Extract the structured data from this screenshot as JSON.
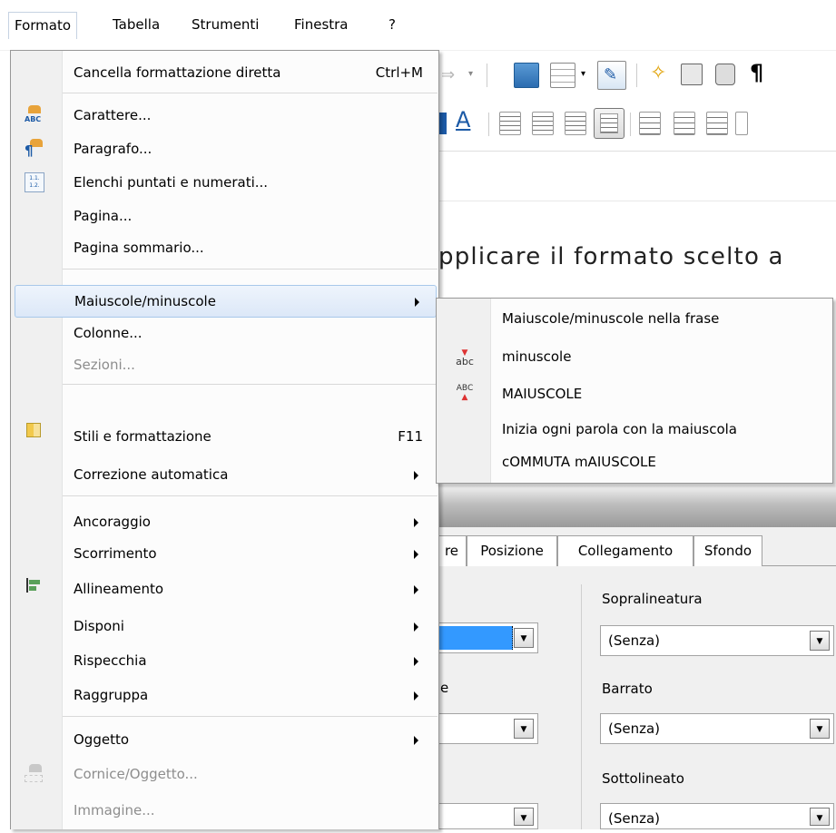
{
  "menubar": {
    "items": [
      "Formato",
      "Tabella",
      "Strumenti",
      "Finestra",
      "?"
    ]
  },
  "document": {
    "text": "pplicare il formato scelto a"
  },
  "format_menu": {
    "items": [
      {
        "label": "Cancella formattazione diretta",
        "shortcut": "Ctrl+M"
      },
      {
        "label": "Carattere...",
        "icon": "character-icon"
      },
      {
        "label": "Paragrafo...",
        "icon": "paragraph-icon"
      },
      {
        "label": "Elenchi puntati e numerati...",
        "icon": "bullets-numbering-icon"
      },
      {
        "label": "Pagina..."
      },
      {
        "label": "Pagina sommario..."
      },
      {
        "label": "Maiuscole/minuscole",
        "submenu": true
      },
      {
        "label": "Colonne..."
      },
      {
        "label": "Sezioni...",
        "disabled": true
      },
      {
        "label": "Stili e formattazione",
        "shortcut": "F11",
        "icon": "styles-icon"
      },
      {
        "label": "Correzione automatica",
        "submenu": true
      },
      {
        "label": "Ancoraggio",
        "submenu": true
      },
      {
        "label": "Scorrimento",
        "submenu": true
      },
      {
        "label": "Allineamento",
        "submenu": true,
        "icon": "align-icon"
      },
      {
        "label": "Disponi",
        "submenu": true
      },
      {
        "label": "Rispecchia",
        "submenu": true
      },
      {
        "label": "Raggruppa",
        "submenu": true
      },
      {
        "label": "Oggetto",
        "submenu": true
      },
      {
        "label": "Cornice/Oggetto...",
        "disabled": true,
        "icon": "frame-icon"
      },
      {
        "label": "Immagine...",
        "disabled": true
      }
    ]
  },
  "case_submenu": {
    "items": [
      {
        "label": "Maiuscole/minuscole nella frase"
      },
      {
        "label": "minuscole",
        "icon": "lowercase-icon",
        "icon_text": "abc"
      },
      {
        "label": "MAIUSCOLE",
        "icon": "uppercase-icon",
        "icon_text": "ABC"
      },
      {
        "label": "Inizia ogni parola con la maiuscola"
      },
      {
        "label": "cOMMUTA mAIUSCOLE"
      }
    ]
  },
  "dialog": {
    "tabs": [
      "re",
      "Posizione",
      "Collegamento",
      "Sfondo"
    ],
    "partial_label": "e",
    "overline_label": "Sopralineatura",
    "overline_value": "(Senza)",
    "strike_label": "Barrato",
    "strike_value": "(Senza)",
    "underline_label": "Sottolineato",
    "underline_value": "(Senza)"
  },
  "colors": {
    "highlight": "#dce8f8",
    "combo_selected": "#3399ff",
    "disabled_text": "#8d8d8d"
  }
}
